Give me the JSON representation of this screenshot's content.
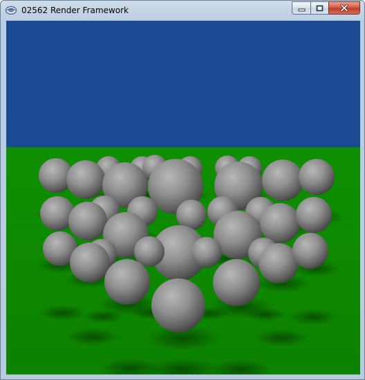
{
  "window": {
    "title": "02562 Render Framework",
    "icon": "app-icon",
    "controls": {
      "minimize": "minimize-icon",
      "maximize": "maximize-icon",
      "close": "close-icon"
    }
  },
  "scene": {
    "description_icon": "render-viewport",
    "colors": {
      "sky": "#1b4a94",
      "ground": "#0e8a00",
      "sphere": "#8d8d8d"
    }
  }
}
